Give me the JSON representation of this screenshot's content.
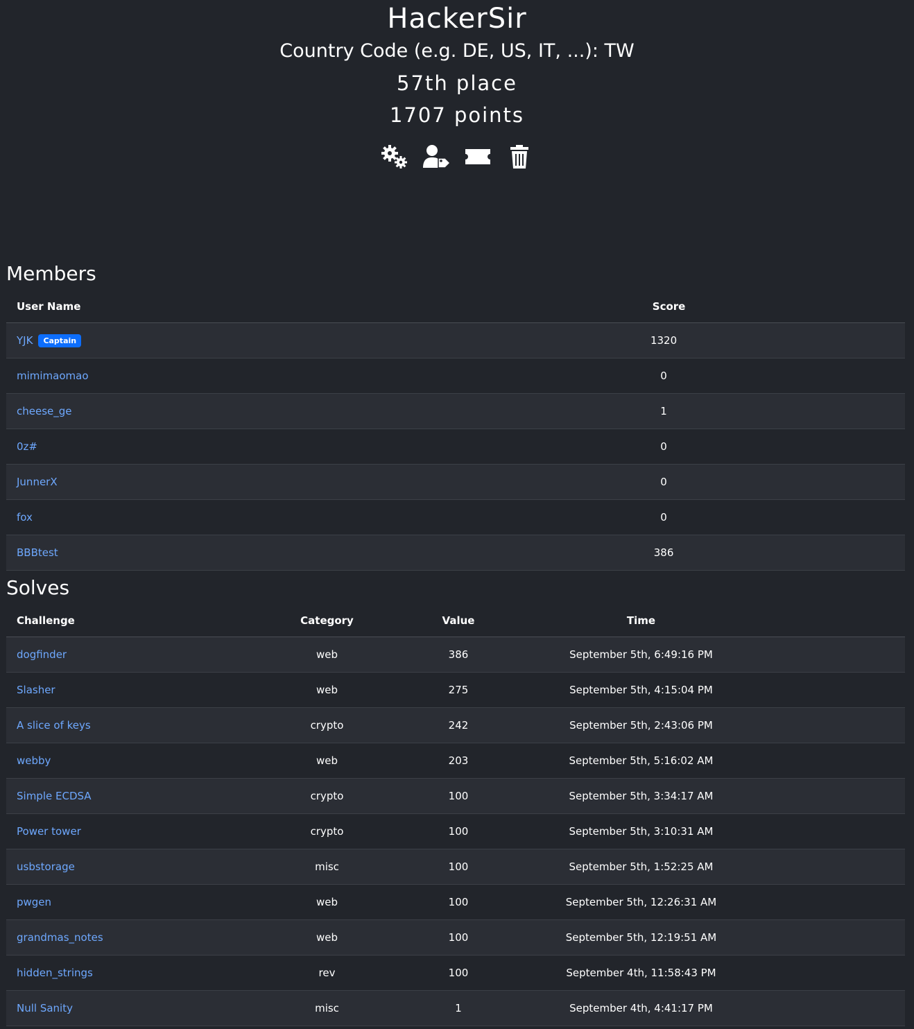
{
  "team": {
    "name": "HackerSir",
    "country": "Country Code (e.g. DE, US, IT, ...): TW",
    "place": "57th place",
    "points": "1707 points"
  },
  "icons": [
    "settings-gears-icon",
    "user-tag-icon",
    "ticket-icon",
    "trash-icon"
  ],
  "colors": {
    "background": "#22252b",
    "row_stripe": "#2b2e35",
    "link": "#6ea8fe",
    "badge": "#0d6efd"
  },
  "members": {
    "title": "Members",
    "headers": {
      "user": "User Name",
      "score": "Score"
    },
    "rows": [
      {
        "name": "YJK",
        "badge": "Captain",
        "score": "1320"
      },
      {
        "name": "mimimaomao",
        "badge": "",
        "score": "0"
      },
      {
        "name": "cheese_ge",
        "badge": "",
        "score": "1"
      },
      {
        "name": "0z#",
        "badge": "",
        "score": "0"
      },
      {
        "name": "JunnerX",
        "badge": "",
        "score": "0"
      },
      {
        "name": "fox",
        "badge": "",
        "score": "0"
      },
      {
        "name": "BBBtest",
        "badge": "",
        "score": "386"
      }
    ]
  },
  "solves": {
    "title": "Solves",
    "headers": {
      "challenge": "Challenge",
      "category": "Category",
      "value": "Value",
      "time": "Time"
    },
    "rows": [
      {
        "challenge": "dogfinder",
        "category": "web",
        "value": "386",
        "time": "September 5th, 6:49:16 PM"
      },
      {
        "challenge": "Slasher",
        "category": "web",
        "value": "275",
        "time": "September 5th, 4:15:04 PM"
      },
      {
        "challenge": "A slice of keys",
        "category": "crypto",
        "value": "242",
        "time": "September 5th, 2:43:06 PM"
      },
      {
        "challenge": "webby",
        "category": "web",
        "value": "203",
        "time": "September 5th, 5:16:02 AM"
      },
      {
        "challenge": "Simple ECDSA",
        "category": "crypto",
        "value": "100",
        "time": "September 5th, 3:34:17 AM"
      },
      {
        "challenge": "Power tower",
        "category": "crypto",
        "value": "100",
        "time": "September 5th, 3:10:31 AM"
      },
      {
        "challenge": "usbstorage",
        "category": "misc",
        "value": "100",
        "time": "September 5th, 1:52:25 AM"
      },
      {
        "challenge": "pwgen",
        "category": "web",
        "value": "100",
        "time": "September 5th, 12:26:31 AM"
      },
      {
        "challenge": "grandmas_notes",
        "category": "web",
        "value": "100",
        "time": "September 5th, 12:19:51 AM"
      },
      {
        "challenge": "hidden_strings",
        "category": "rev",
        "value": "100",
        "time": "September 4th, 11:58:43 PM"
      },
      {
        "challenge": "Null Sanity",
        "category": "misc",
        "value": "1",
        "time": "September 4th, 4:41:17 PM"
      }
    ]
  }
}
